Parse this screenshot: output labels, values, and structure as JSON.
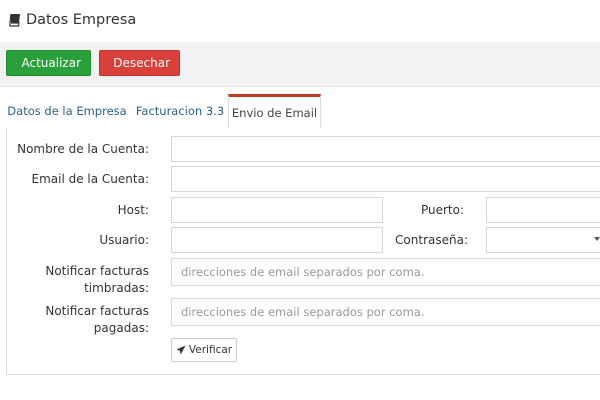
{
  "header": {
    "title": "Datos Empresa",
    "icon": "book-icon"
  },
  "toolbar": {
    "update_label": "Actualizar",
    "discard_label": "Desechar"
  },
  "tabs": [
    {
      "label": "Datos de la Empresa",
      "active": false
    },
    {
      "label": "Facturacion 3.3",
      "active": false
    },
    {
      "label": "Envio de Email",
      "active": true
    }
  ],
  "form": {
    "account_name_label": "Nombre de la Cuenta:",
    "account_name_value": "",
    "account_email_label": "Email de la Cuenta:",
    "account_email_value": "",
    "host_label": "Host:",
    "host_value": "",
    "port_label": "Puerto:",
    "port_value": "",
    "user_label": "Usuario:",
    "user_value": "",
    "password_label": "Contraseña:",
    "password_value": "",
    "notify_stamped_label_1": "Notificar facturas",
    "notify_stamped_label_2": "timbradas:",
    "notify_stamped_placeholder": "direcciones de email separados por coma.",
    "notify_paid_label_1": "Notificar facturas",
    "notify_paid_label_2": "pagadas:",
    "notify_paid_placeholder": "direcciones de email separados por coma.",
    "verify_label": "Verificar"
  },
  "colors": {
    "update": "#2aa03a",
    "discard": "#d9403a",
    "active_tab_border": "#c23b22",
    "link": "#2c5f8a"
  }
}
